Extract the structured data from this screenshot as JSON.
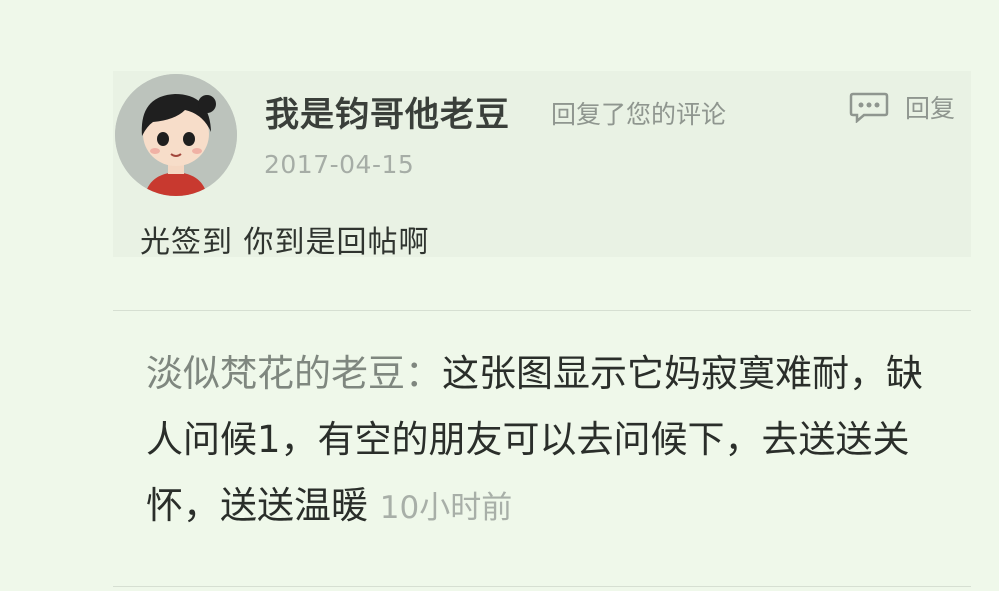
{
  "quoted_comment": {
    "username": "我是钧哥他老豆",
    "action": "回复了您的评论",
    "reply_label": "回复",
    "date": "2017-04-15",
    "text": "光签到 你到是回帖啊"
  },
  "reply": {
    "user": "淡似梵花的老豆",
    "separator": "：",
    "text": "这张图显示它妈寂寞难耐，缺人问候1，有空的朋友可以去问候下，去送送关怀，送送温暖",
    "time": "10小时前"
  },
  "icons": {
    "avatar": "cartoon-girl-avatar",
    "reply": "comment-bubble-icon"
  }
}
